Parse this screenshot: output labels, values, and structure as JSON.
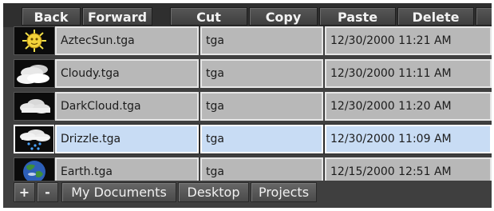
{
  "toolbar": {
    "buttons": [
      {
        "label": "Back"
      },
      {
        "label": "Forward"
      },
      {
        "label": "Cut"
      },
      {
        "label": "Copy"
      },
      {
        "label": "Paste"
      },
      {
        "label": "Delete"
      }
    ]
  },
  "files": [
    {
      "name": "AztecSun.tga",
      "type": "tga",
      "modified": "12/30/2000 11:21 AM",
      "icon": "sun-icon",
      "selected": false
    },
    {
      "name": "Cloudy.tga",
      "type": "tga",
      "modified": "12/30/2000 11:11 AM",
      "icon": "cloudy-icon",
      "selected": false
    },
    {
      "name": "DarkCloud.tga",
      "type": "tga",
      "modified": "12/30/2000 11:20 AM",
      "icon": "dark-cloud-icon",
      "selected": false
    },
    {
      "name": "Drizzle.tga",
      "type": "tga",
      "modified": "12/30/2000 11:09 AM",
      "icon": "drizzle-icon",
      "selected": true
    },
    {
      "name": "Earth.tga",
      "type": "tga",
      "modified": "12/15/2000 12:51 AM",
      "icon": "earth-icon",
      "selected": false
    }
  ],
  "bottombar": {
    "add_label": "+",
    "remove_label": "-",
    "locations": [
      "My Documents",
      "Desktop",
      "Projects"
    ]
  },
  "colors": {
    "background": "#3f3f3f",
    "cell": "#b8b8b8",
    "selected_cell": "#c8dcf4"
  }
}
